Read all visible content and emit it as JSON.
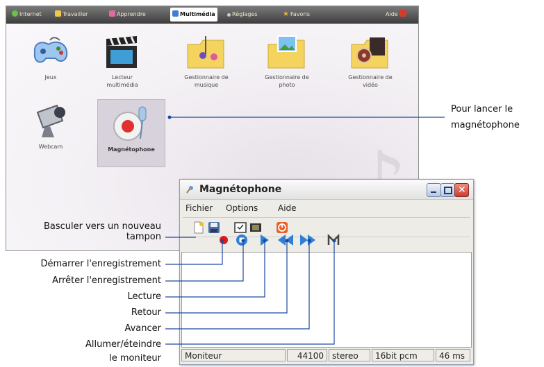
{
  "desktop": {
    "tabs": [
      {
        "label": "Internet",
        "icon": "globe-icon",
        "color": "#6cc04a"
      },
      {
        "label": "Travailler",
        "icon": "briefcase-icon",
        "color": "#f0c84a"
      },
      {
        "label": "Apprendre",
        "icon": "book-icon",
        "color": "#e06aa0"
      },
      {
        "label": "Multimédia",
        "icon": "media-icon",
        "color": "#3f7fd0"
      },
      {
        "label": "Réglages",
        "icon": "settings-icon",
        "color": "#cccccc"
      },
      {
        "label": "Favoris",
        "icon": "star-icon",
        "color": "#f0b020"
      }
    ],
    "help": "Aide",
    "apps": [
      {
        "label": "Jeux",
        "icon": "gamepad-icon"
      },
      {
        "label": "Lecteur multimédia",
        "icon": "clapperboard-icon"
      },
      {
        "label": "Gestionnaire de musique",
        "icon": "music-folder-icon"
      },
      {
        "label": "Gestionnaire de photo",
        "icon": "photo-folder-icon"
      },
      {
        "label": "Gestionnaire de vidéo",
        "icon": "video-folder-icon"
      },
      {
        "label": "Webcam",
        "icon": "webcam-icon"
      },
      {
        "label": "Magnétophone",
        "icon": "recorder-icon"
      }
    ]
  },
  "recorder": {
    "title": "Magnétophone",
    "menu": [
      "Fichier",
      "Options",
      "Aide"
    ],
    "toolbar_icons": [
      "new-document-icon",
      "save-icon",
      "select-icon",
      "film-icon",
      "power-icon"
    ],
    "controls": [
      "record-icon",
      "stop-icon",
      "play-icon",
      "rewind-icon",
      "forward-icon",
      "monitor-icon"
    ],
    "status": [
      "Moniteur",
      "44100",
      "stereo",
      "16bit pcm",
      "46 ms"
    ]
  },
  "annotations": {
    "launch": [
      "Pour lancer le",
      "magnétophone"
    ],
    "new_buffer": [
      "Basculer vers un nouveau",
      "tampon"
    ],
    "start_rec": "Démarrer l'enregistrement",
    "stop_rec": "Arrêter l'enregistrement",
    "play": "Lecture",
    "back": "Retour",
    "forward": "Avancer",
    "monitor": [
      "Allumer/éteindre",
      "le moniteur"
    ]
  }
}
